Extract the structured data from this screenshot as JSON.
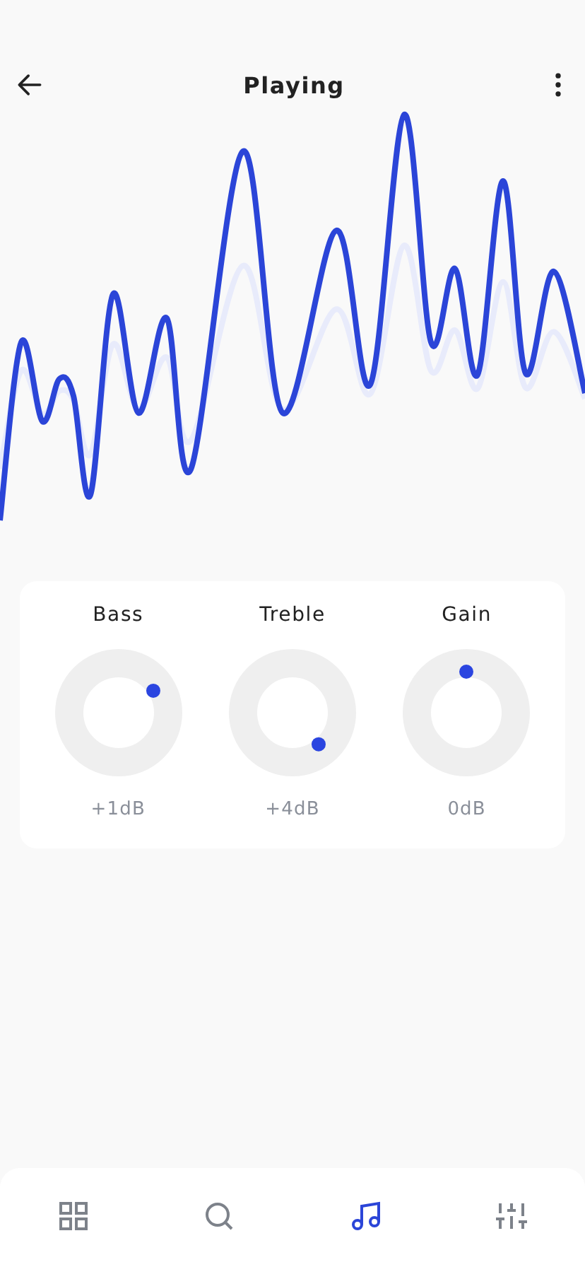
{
  "header": {
    "title": "Playing"
  },
  "controls": [
    {
      "label": "Bass",
      "reading": "+1dB"
    },
    {
      "label": "Treble",
      "reading": "+4dB"
    },
    {
      "label": "Gain",
      "reading": "0dB"
    }
  ],
  "nav": [
    {
      "kind": "grid",
      "selected": false
    },
    {
      "kind": "search",
      "selected": false
    },
    {
      "kind": "music",
      "selected": true
    },
    {
      "kind": "sliders",
      "selected": false
    }
  ]
}
